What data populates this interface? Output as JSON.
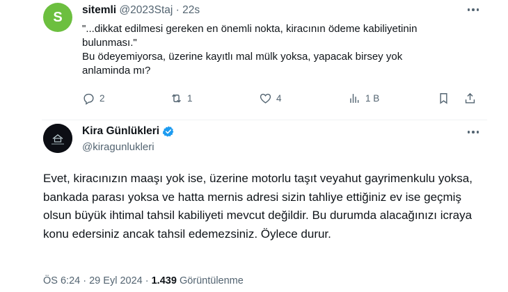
{
  "reply": {
    "avatar_letter": "S",
    "avatar_color": "#6cbf3f",
    "name": "sitemli",
    "handle": "@2023Staj",
    "separator": "·",
    "time": "22s",
    "text_line1": "\"...dikkat edilmesi gereken en önemli nokta, kiracının ödeme kabiliyetinin bulunması.\"",
    "text_line2": "Bu ödeyemiyorsa, üzerine kayıtlı mal mülk yoksa, yapacak birsey yok anlaminda mı?",
    "actions": {
      "reply_count": "2",
      "retweet_count": "1",
      "like_count": "4",
      "view_count": "1 B"
    }
  },
  "main": {
    "name": "Kira Günlükleri",
    "handle": "@kiragunlukleri",
    "verified_color": "#1d9bf0",
    "text": "Evet, kiracınızın maaşı yok ise, üzerine motorlu taşıt veyahut gayrimenkulu yoksa, bankada parası yoksa ve hatta mernis adresi sizin tahliye ettiğiniz ev ise geçmiş olsun büyük ihtimal tahsil kabiliyeti mevcut değildir. Bu durumda alacağınızı icraya konu edersiniz ancak tahsil edemezsiniz. Öylece durur.",
    "time": "ÖS 6:24",
    "date": "29 Eyl 2024",
    "separator": "·",
    "views": "1.439",
    "views_label": "Görüntülenme"
  }
}
